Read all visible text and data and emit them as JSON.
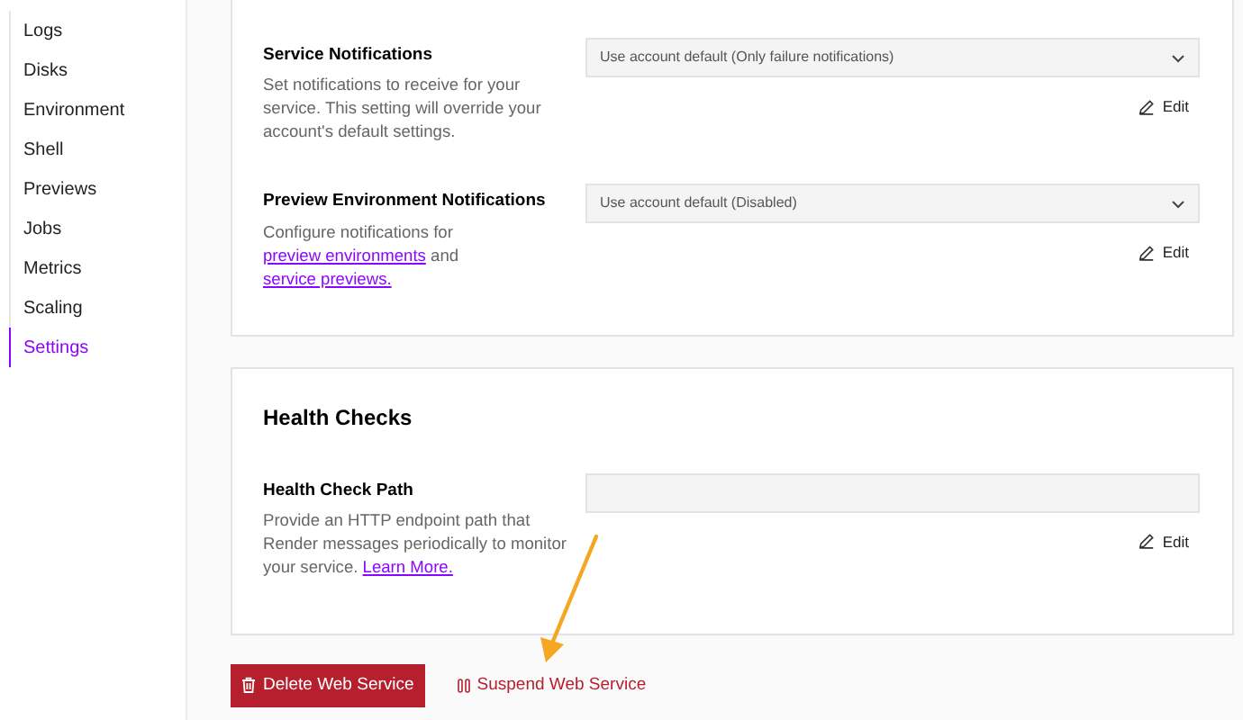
{
  "sidebar": {
    "items": [
      {
        "label": "Logs",
        "selected": false
      },
      {
        "label": "Disks",
        "selected": false
      },
      {
        "label": "Environment",
        "selected": false
      },
      {
        "label": "Shell",
        "selected": false
      },
      {
        "label": "Previews",
        "selected": false
      },
      {
        "label": "Jobs",
        "selected": false
      },
      {
        "label": "Metrics",
        "selected": false
      },
      {
        "label": "Scaling",
        "selected": false
      },
      {
        "label": "Settings",
        "selected": true
      }
    ]
  },
  "cards": [
    {
      "settings": [
        {
          "title": "Service Notifications",
          "description": [
            {
              "kind": "text",
              "text": "Set notifications to receive for your service. This setting will override your account's default settings."
            }
          ],
          "control": {
            "kind": "select",
            "value": "Use account default (Only failure notifications)"
          },
          "edit": "Edit"
        },
        {
          "title": "Preview Environment Notifications",
          "description": [
            {
              "kind": "text",
              "text": "Configure notifications for "
            },
            {
              "kind": "link",
              "text": "preview environments"
            },
            {
              "kind": "text",
              "text": " and "
            },
            {
              "kind": "link",
              "text": "service previews."
            }
          ],
          "control": {
            "kind": "select",
            "value": "Use account default (Disabled)"
          },
          "edit": "Edit"
        }
      ]
    },
    {
      "heading": "Health Checks",
      "settings": [
        {
          "title": "Health Check Path",
          "description": [
            {
              "kind": "text",
              "text": "Provide an HTTP endpoint path that Render messages periodically to monitor your service. "
            },
            {
              "kind": "link",
              "text": "Learn More."
            }
          ],
          "control": {
            "kind": "input"
          },
          "edit": "Edit"
        }
      ]
    }
  ],
  "actions": {
    "delete": "Delete Web Service",
    "suspend": "Suspend Web Service"
  }
}
